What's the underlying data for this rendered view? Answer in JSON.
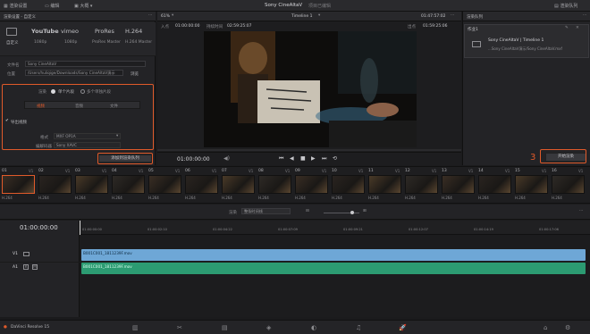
{
  "topbar": {
    "render_settings": "渲染设置",
    "edit": "编辑",
    "large": "大概",
    "project_title": "Sony CineAltaV",
    "project_sub": "项目已编辑",
    "render_queue": "渲染队列"
  },
  "render_settings": {
    "header": "渲染设置 - 自定义",
    "presets": [
      "自定义",
      "YouTube",
      "vimeo",
      "ProRes",
      "H.264"
    ],
    "preset_subs": [
      "",
      "1080p",
      "1080p",
      "ProRes Master",
      "H.264 Master"
    ],
    "filename_label": "文件名",
    "filename_value": "Sony CineAltaV",
    "location_label": "位置",
    "location_value": "/Users/huliqige/Downloads/Sony CineAltaV演示",
    "browse": "浏览",
    "render_label": "渲染",
    "single_clip": "单个片段",
    "individual_clips": "多个单独片段",
    "tabs": [
      "视频",
      "音频",
      "文件"
    ],
    "export_video": "导出视频",
    "format_label": "格式",
    "format_value": "MXF OP1A",
    "codec_label": "编解码器",
    "codec_value": "Sony XAVC",
    "add_queue": "添加到渲染队列"
  },
  "viewer": {
    "zoom": "61%",
    "timeline_name": "Timeline 1",
    "timecode_top": "01:47:57:02",
    "in_label": "入点",
    "in_tc": "01:00:00:00",
    "dur_label": "持续时间",
    "dur_tc": "02:59:25:07",
    "out_label": "出点",
    "out_tc": "01:59:25:06",
    "current_tc": "01:00:00:00"
  },
  "queue": {
    "header": "渲染队列",
    "job": "作业1",
    "job_title": "Sony CineAltaV | Timeline 1",
    "job_path": "...Sony CineAltaV演示/Sony CineAltaV.mxf",
    "start_render": "开始渲染"
  },
  "thumbs": [
    {
      "num": "01",
      "v": "V1",
      "codec": "H.264"
    },
    {
      "num": "02",
      "v": "V1",
      "codec": "H.264"
    },
    {
      "num": "03",
      "v": "V1",
      "codec": "H.264"
    },
    {
      "num": "04",
      "v": "V1",
      "codec": "H.264"
    },
    {
      "num": "05",
      "v": "V1",
      "codec": "H.264"
    },
    {
      "num": "06",
      "v": "V1",
      "codec": "H.264"
    },
    {
      "num": "07",
      "v": "V1",
      "codec": "H.264"
    },
    {
      "num": "08",
      "v": "V1",
      "codec": "H.264"
    },
    {
      "num": "09",
      "v": "V1",
      "codec": "H.264"
    },
    {
      "num": "10",
      "v": "V1",
      "codec": "H.264"
    },
    {
      "num": "11",
      "v": "V1",
      "codec": "H.264"
    },
    {
      "num": "12",
      "v": "V1",
      "codec": "H.264"
    },
    {
      "num": "13",
      "v": "V1",
      "codec": "H.264"
    },
    {
      "num": "14",
      "v": "V1",
      "codec": "H.264"
    },
    {
      "num": "15",
      "v": "V1",
      "codec": "H.264"
    },
    {
      "num": "16",
      "v": "V1",
      "codec": "H.264"
    }
  ],
  "timeline": {
    "render_label": "渲染",
    "render_mode": "整条时间线",
    "main_tc": "01:00:00:00",
    "ruler": [
      "01:00:00:00",
      "01:00:02:10",
      "01:00:04:22",
      "01:00:07:09",
      "01:00:09:21",
      "01:00:12:07",
      "01:00:14:19",
      "01:00:17:06"
    ],
    "v1": "V1",
    "a1": "A1",
    "video_clip": "B001C001_1811239F.mov",
    "audio_clip": "B001C001_1811239F.mov"
  },
  "annotations": [
    "1",
    "2",
    "3"
  ],
  "footer": {
    "app": "DaVinci Resolve 15"
  }
}
